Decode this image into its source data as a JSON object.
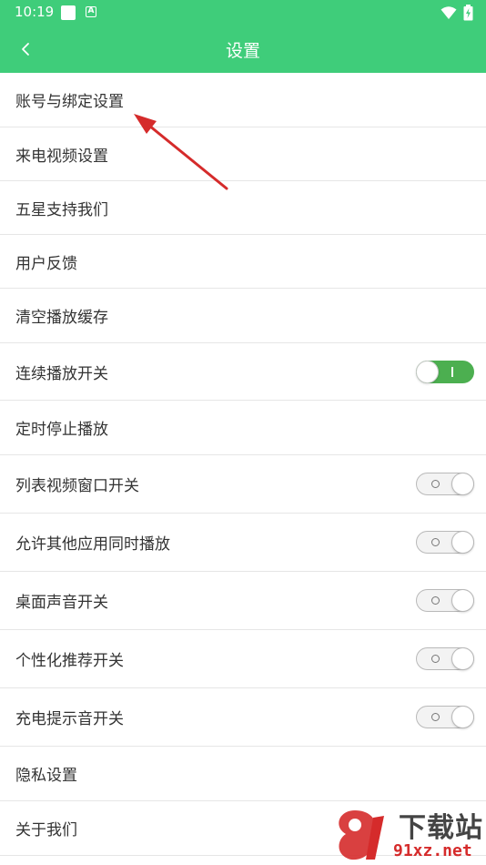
{
  "status_bar": {
    "time": "10:19",
    "notif_icon_letter": "A"
  },
  "header": {
    "title": "设置"
  },
  "settings": [
    {
      "label": "账号与绑定设置"
    },
    {
      "label": "来电视频设置"
    },
    {
      "label": "五星支持我们"
    },
    {
      "label": "用户反馈"
    },
    {
      "label": "清空播放缓存"
    },
    {
      "label": "连续播放开关",
      "toggle": "on"
    },
    {
      "label": "定时停止播放"
    },
    {
      "label": "列表视频窗口开关",
      "toggle": "off"
    },
    {
      "label": "允许其他应用同时播放",
      "toggle": "off"
    },
    {
      "label": "桌面声音开关",
      "toggle": "off"
    },
    {
      "label": "个性化推荐开关",
      "toggle": "off"
    },
    {
      "label": "充电提示音开关",
      "toggle": "off"
    },
    {
      "label": "隐私设置"
    },
    {
      "label": "关于我们"
    }
  ],
  "watermark": {
    "top": "下载站",
    "bottom": "91xz.net"
  },
  "colors": {
    "accent": "#3fcd7a",
    "toggle_on": "#4caf50",
    "arrow": "#d52b2b"
  }
}
